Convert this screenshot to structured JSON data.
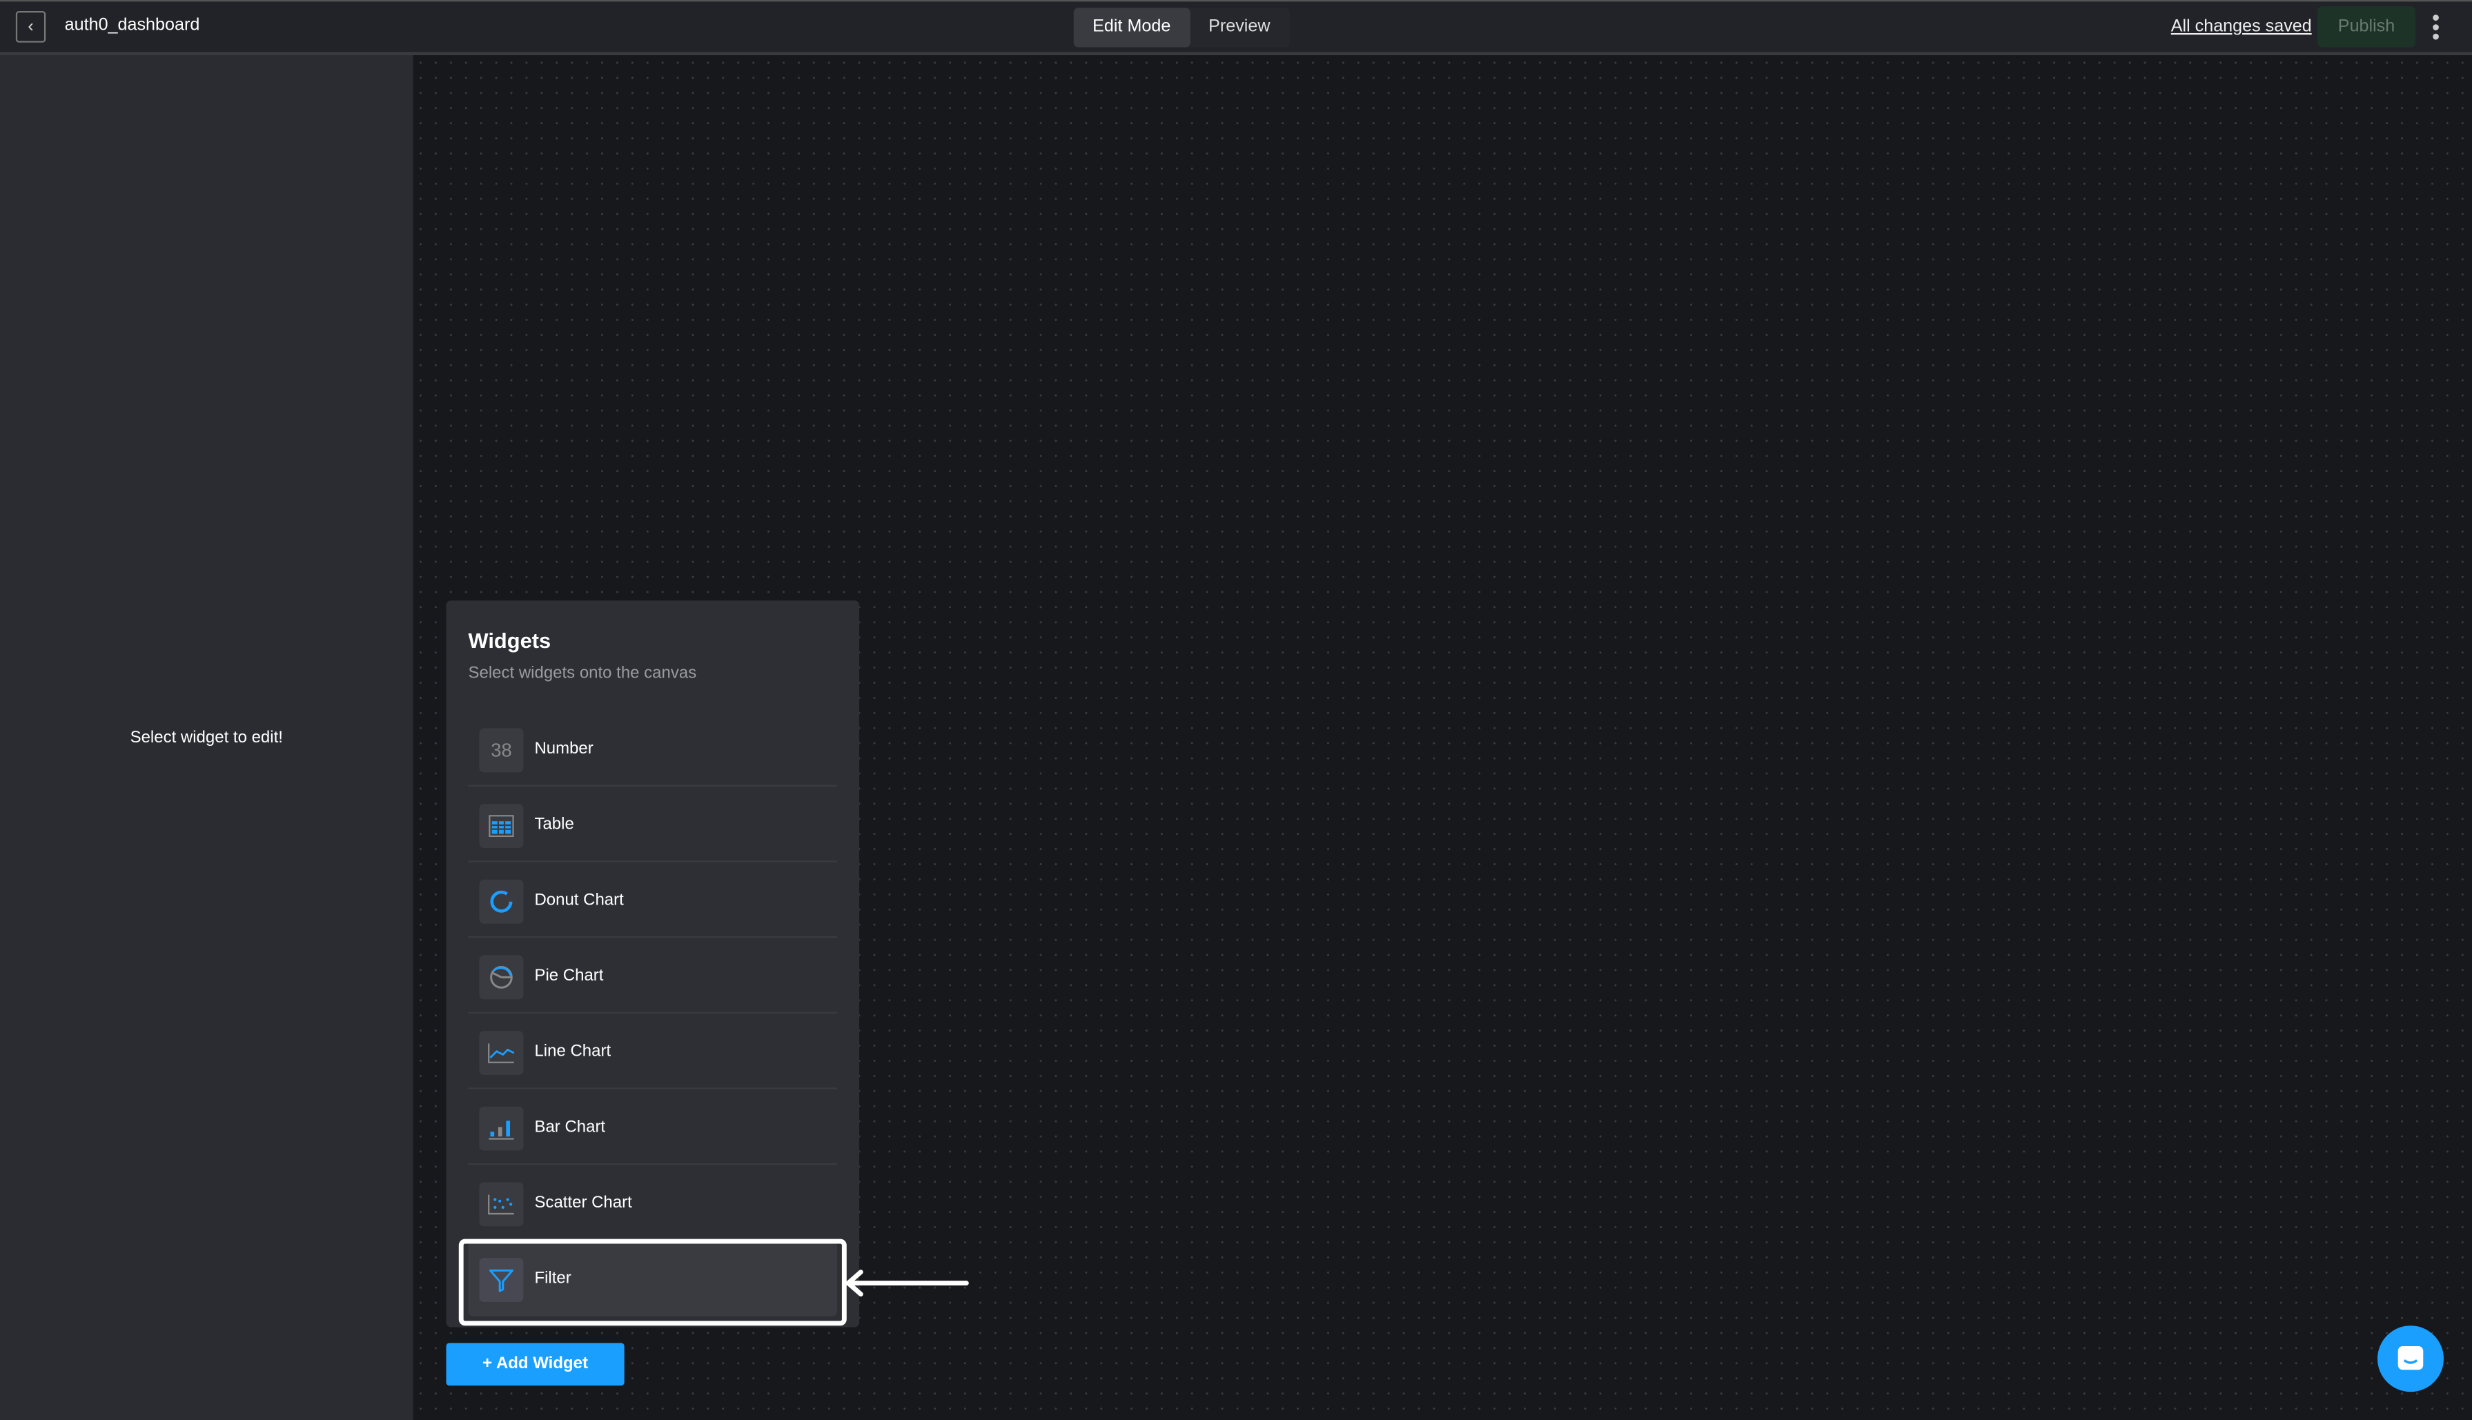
{
  "header": {
    "title": "auth0_dashboard",
    "modes": [
      "Edit Mode",
      "Preview"
    ],
    "active_mode": "Edit Mode",
    "save_status": "All changes saved",
    "publish_label": "Publish"
  },
  "sidebar": {
    "message": "Select widget to edit!"
  },
  "widgets_panel": {
    "title": "Widgets",
    "subtitle": "Select widgets onto the canvas",
    "number_icon_text": "38",
    "items": [
      {
        "label": "Number",
        "icon": "number-icon"
      },
      {
        "label": "Table",
        "icon": "table-icon"
      },
      {
        "label": "Donut Chart",
        "icon": "donut-chart-icon"
      },
      {
        "label": "Pie Chart",
        "icon": "pie-chart-icon"
      },
      {
        "label": "Line Chart",
        "icon": "line-chart-icon"
      },
      {
        "label": "Bar Chart",
        "icon": "bar-chart-icon"
      },
      {
        "label": "Scatter Chart",
        "icon": "scatter-chart-icon"
      },
      {
        "label": "Filter",
        "icon": "filter-icon"
      }
    ],
    "highlighted": "Filter"
  },
  "add_widget_label": "+ Add Widget",
  "colors": {
    "accent": "#1a9fff",
    "background": "#17181c",
    "sidebar": "#2b2c31",
    "panel": "#2e2f35"
  }
}
